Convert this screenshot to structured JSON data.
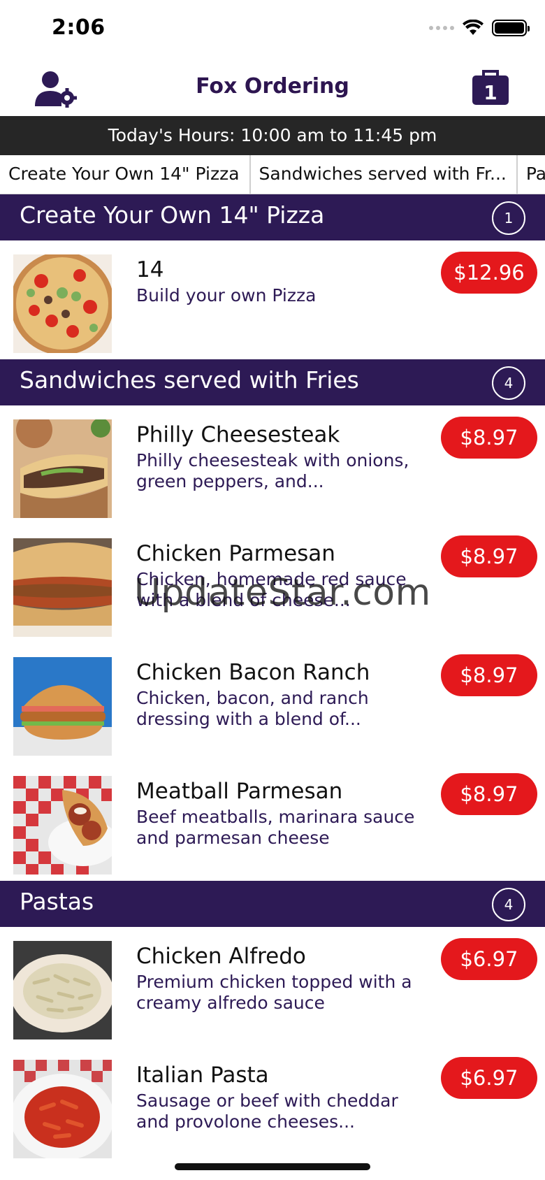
{
  "status": {
    "time": "2:06"
  },
  "header": {
    "title": "Fox Ordering",
    "cart_count": "1"
  },
  "hours": {
    "text": "Today's Hours: 10:00 am to 11:45 pm"
  },
  "category_tabs": [
    {
      "label": "Create Your Own 14\" Pizza"
    },
    {
      "label": "Sandwiches served with Fr..."
    },
    {
      "label": "Pa"
    }
  ],
  "sections": [
    {
      "title": "Create Your Own 14\" Pizza",
      "count": "1",
      "items": [
        {
          "name": "14",
          "description": "Build your own Pizza",
          "price": "$12.96",
          "image": "pizza-photo"
        }
      ]
    },
    {
      "title": "Sandwiches served with Fries",
      "count": "4",
      "items": [
        {
          "name": "Philly Cheesesteak",
          "description": "Philly cheesesteak with onions, green peppers, and...",
          "price": "$8.97",
          "image": "philly-photo"
        },
        {
          "name": "Chicken Parmesan",
          "description": "Chicken, homemade red sauce with a blend of cheese...",
          "price": "$8.97",
          "image": "chicken-parm-photo"
        },
        {
          "name": "Chicken Bacon Ranch",
          "description": "Chicken, bacon, and ranch dressing with a blend of...",
          "price": "$8.97",
          "image": "burger-photo"
        },
        {
          "name": "Meatball Parmesan",
          "description": "Beef meatballs, marinara sauce and parmesan cheese",
          "price": "$8.97",
          "image": "meatball-photo"
        }
      ]
    },
    {
      "title": "Pastas",
      "count": "4",
      "items": [
        {
          "name": "Chicken Alfredo",
          "description": "Premium chicken topped with a creamy alfredo sauce",
          "price": "$6.97",
          "image": "alfredo-photo"
        },
        {
          "name": "Italian Pasta",
          "description": "Sausage or beef with cheddar and provolone cheeses...",
          "price": "$6.97",
          "image": "italian-pasta-photo"
        }
      ]
    }
  ],
  "watermark": "UpdateStar.com",
  "colors": {
    "brand_purple": "#2d1a55",
    "price_red": "#e4181c",
    "hours_bg": "#262626"
  }
}
